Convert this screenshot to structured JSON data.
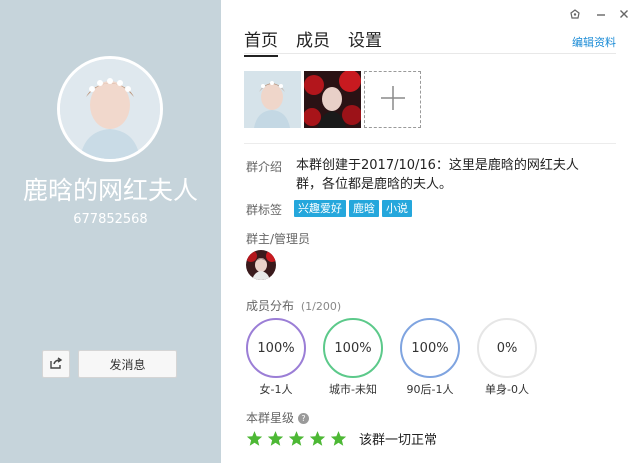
{
  "profile": {
    "group_name": "鹿晗的网红夫人",
    "group_id": "677852568",
    "message_button": "发消息",
    "share_icon": "share-icon"
  },
  "tabs": [
    {
      "label": "首页",
      "active": true
    },
    {
      "label": "成员",
      "active": false
    },
    {
      "label": "设置",
      "active": false
    }
  ],
  "edit_link": "编辑资料",
  "window_controls": [
    "skin-icon",
    "minimize-icon",
    "close-icon"
  ],
  "intro": {
    "label": "群介绍",
    "text": "本群创建于2017/10/16：这里是鹿晗的网红夫人群，各位都是鹿晗的夫人。"
  },
  "tags": {
    "label": "群标签",
    "items": [
      "兴趣爱好",
      "鹿晗",
      "小说"
    ]
  },
  "admins": {
    "label": "群主/管理员"
  },
  "distribution": {
    "label": "成员分布",
    "count": "(1/200)",
    "stats": [
      {
        "value": "100%",
        "label": "女-1人",
        "color": "#9b7ed6",
        "percent": 100
      },
      {
        "value": "100%",
        "label": "城市-未知",
        "color": "#5cc98a",
        "percent": 100
      },
      {
        "value": "100%",
        "label": "90后-1人",
        "color": "#7fa4e0",
        "percent": 100
      },
      {
        "value": "0%",
        "label": "单身-0人",
        "color": "#e3e3e3",
        "percent": 0
      }
    ]
  },
  "rating": {
    "label": "本群星级",
    "stars": 5,
    "status": "该群一切正常",
    "star_color": "#4db835"
  },
  "colors": {
    "left_panel": "#c6d4db",
    "accent": "#1a8bd6",
    "tag": "#25a7dc"
  }
}
